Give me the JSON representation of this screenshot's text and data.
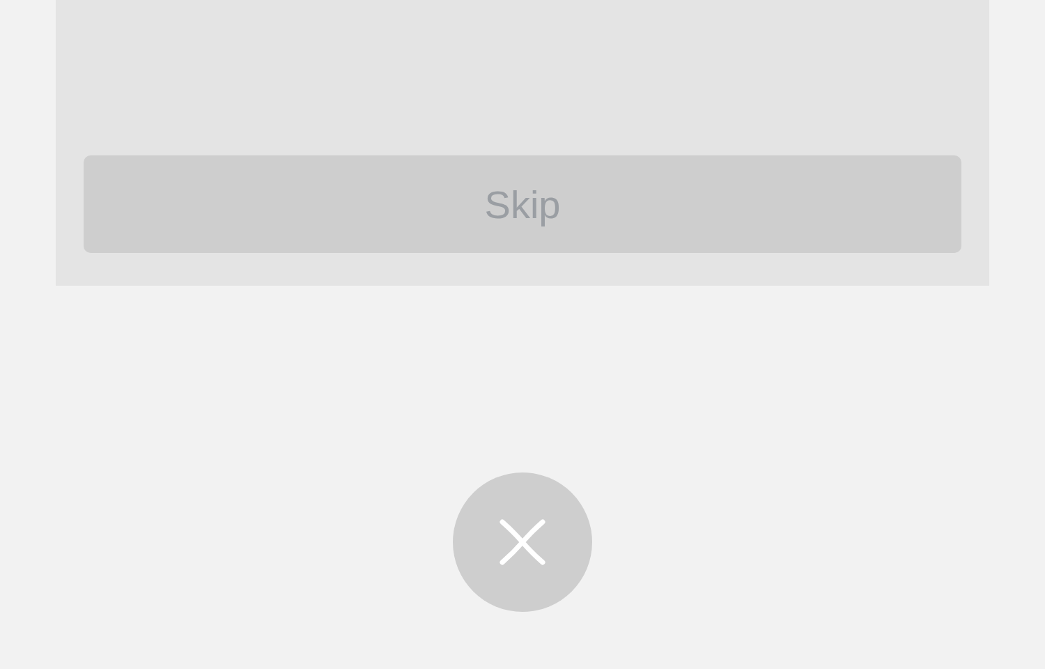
{
  "skip_button": {
    "label": "Skip",
    "disabled": true
  },
  "close_button": {
    "kind": "close"
  }
}
